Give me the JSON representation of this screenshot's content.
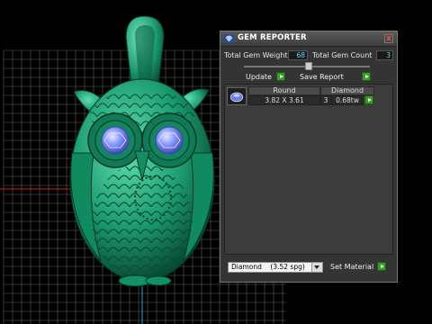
{
  "panel": {
    "title": "GEM REPORTER",
    "close_glyph": "x",
    "total_weight_label": "Total Gem Weight",
    "total_weight_value": "68",
    "total_count_label": "Total Gem Count",
    "total_count_value": "3",
    "update_label": "Update",
    "save_report_label": "Save Report"
  },
  "gem_table": {
    "rows": [
      {
        "shape": "Round",
        "size": "3.82 X 3.61",
        "material": "Diamond",
        "count": "3",
        "weight": "0.68tw"
      }
    ]
  },
  "material": {
    "selected": "Diamond",
    "spg": "(3.52 spg)",
    "set_label": "Set Material"
  },
  "colors": {
    "model": "#1c9b70",
    "gem": "#8c9cff",
    "value_text": "#6fd0ff",
    "go_button": "#3a9a2a"
  },
  "icons": [
    "gem-reporter-icon",
    "close-icon",
    "play-arrow-icon",
    "dropdown-arrow-icon"
  ]
}
